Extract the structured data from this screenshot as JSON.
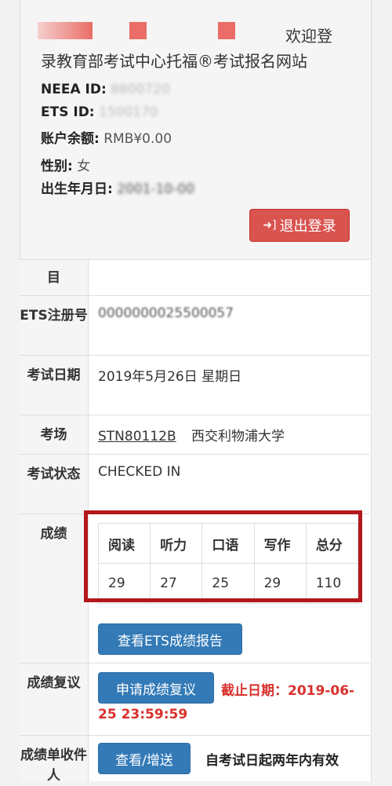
{
  "header": {
    "welcome_tail": "欢迎登",
    "site_name": "录教育部考试中心托福®考试报名网站",
    "neea_label": "NEEA ID:",
    "neea_value": "8800720",
    "ets_label": "ETS ID:",
    "ets_value": "1500170",
    "balance_label": "账户余额:",
    "balance_value": "RMB¥0.00",
    "gender_label": "性别:",
    "gender_value": "女",
    "dob_label": "出生年月日:",
    "dob_value": "2001-10-00",
    "logout_label": "退出登录",
    "logout_icon": "sign-out-icon"
  },
  "rows": {
    "item_label": "目",
    "ets_reg_label": "ETS注册号",
    "ets_reg_value": "0000000025500057",
    "date_label": "考试日期",
    "date_value": "2019年5月26日 星期日",
    "venue_label": "考场",
    "venue_code": "STN80112B",
    "venue_name": "西交利物浦大学",
    "status_label": "考试状态",
    "status_value": "CHECKED IN",
    "score_label": "成绩",
    "review_label": "成绩复议",
    "recipient_label": "成绩单收件人"
  },
  "scores": {
    "headers": [
      "阅读",
      "听力",
      "口语",
      "写作",
      "总分"
    ],
    "values": [
      "29",
      "27",
      "25",
      "29",
      "110"
    ]
  },
  "actions": {
    "view_report": "查看ETS成绩报告",
    "apply_review": "申请成绩复议",
    "deadline_line1": "截止日期：2019-06-",
    "deadline_line2": "25 23:59:59",
    "view_add": "查看/增送",
    "validity_note": "自考试日起两年内有效"
  },
  "colors": {
    "danger": "#d9534f",
    "primary": "#337ab7",
    "highlight": "#b3191c",
    "deadline": "#d9302c"
  }
}
